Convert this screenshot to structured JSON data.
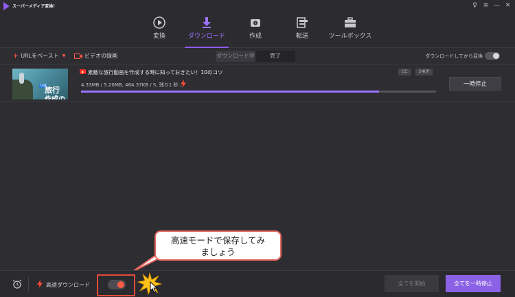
{
  "app": {
    "title": "スーパーメディア変換！"
  },
  "window_controls": {
    "user": "♀",
    "menu": "≡",
    "minimize": "—",
    "close": "✕"
  },
  "nav": {
    "tabs": [
      {
        "label": "変換",
        "icon": "convert-icon"
      },
      {
        "label": "ダウンロード",
        "icon": "download-icon",
        "active": true
      },
      {
        "label": "作成",
        "icon": "burn-disc-icon"
      },
      {
        "label": "転送",
        "icon": "transfer-icon"
      },
      {
        "label": "ツールボックス",
        "icon": "toolbox-icon"
      }
    ]
  },
  "toolbar": {
    "paste_url": "URLをペースト",
    "record_video": "ビデオの録画",
    "segment_downloading": "ダウンロード中",
    "segment_finished": "完了",
    "convert_after_download": "ダウンロードしてから変換"
  },
  "download_item": {
    "title": "素敵な旅行動画を作成する時に知っておきたい！10のコツ",
    "badge_cc": "CC",
    "badge_quality": "240P",
    "stats": "4.33MB / 5.20MB, 464.37KB / S, 残り1 秒...",
    "progress": 0.84,
    "pause_label": "一時停止",
    "thumb_badge": "10選",
    "thumb_line1": "旅行",
    "thumb_line2": "作成の"
  },
  "callout": {
    "text_line1": "高速モードで保存してみ",
    "text_line2": "ましょう"
  },
  "bottom": {
    "high_speed_label": "高速ダウンロード",
    "high_speed_on": true,
    "start_all": "全てを開始",
    "pause_all": "全てを一時停止"
  },
  "colors": {
    "accent": "#8e5cf0",
    "highlight": "#e34b3a",
    "toggle_on": "#ff5b45"
  }
}
